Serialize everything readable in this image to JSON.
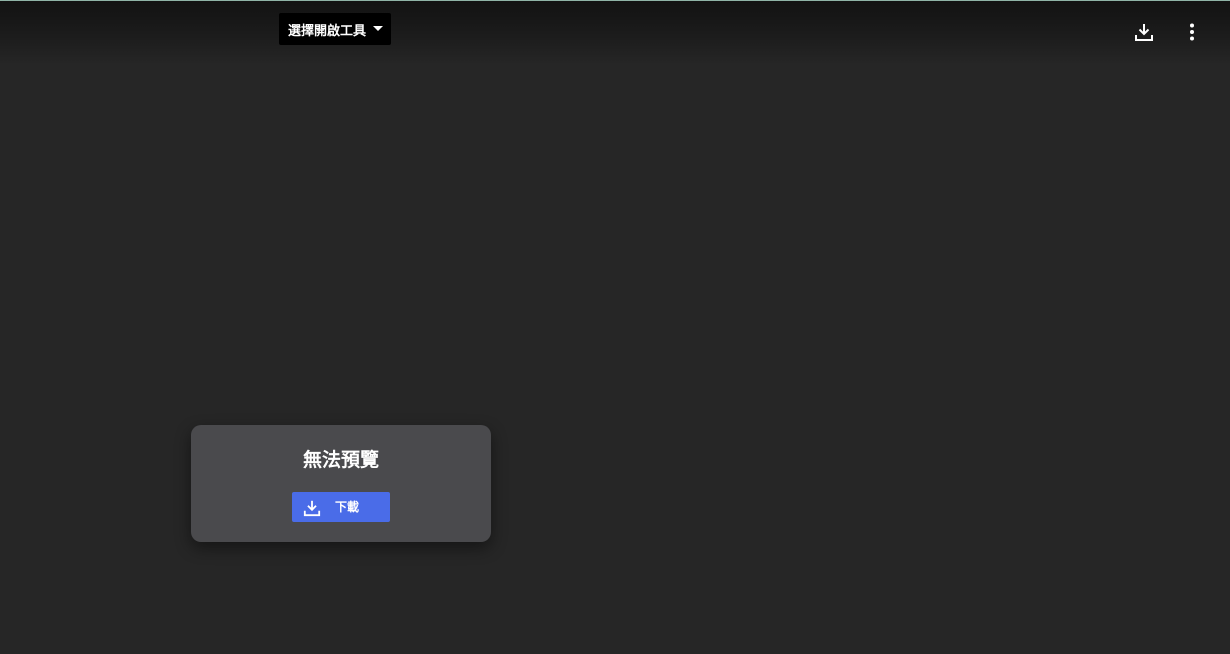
{
  "toolbar": {
    "open_with_label": "選擇開啟工具",
    "download_icon": "download-icon",
    "more_icon": "more-vert-icon"
  },
  "preview": {
    "message": "無法預覽",
    "download_label": "下載",
    "download_icon": "download-icon"
  },
  "colors": {
    "background": "#262626",
    "card": "#4a4a4d",
    "button": "#4a6ce8",
    "open_with_bg": "#000000"
  }
}
